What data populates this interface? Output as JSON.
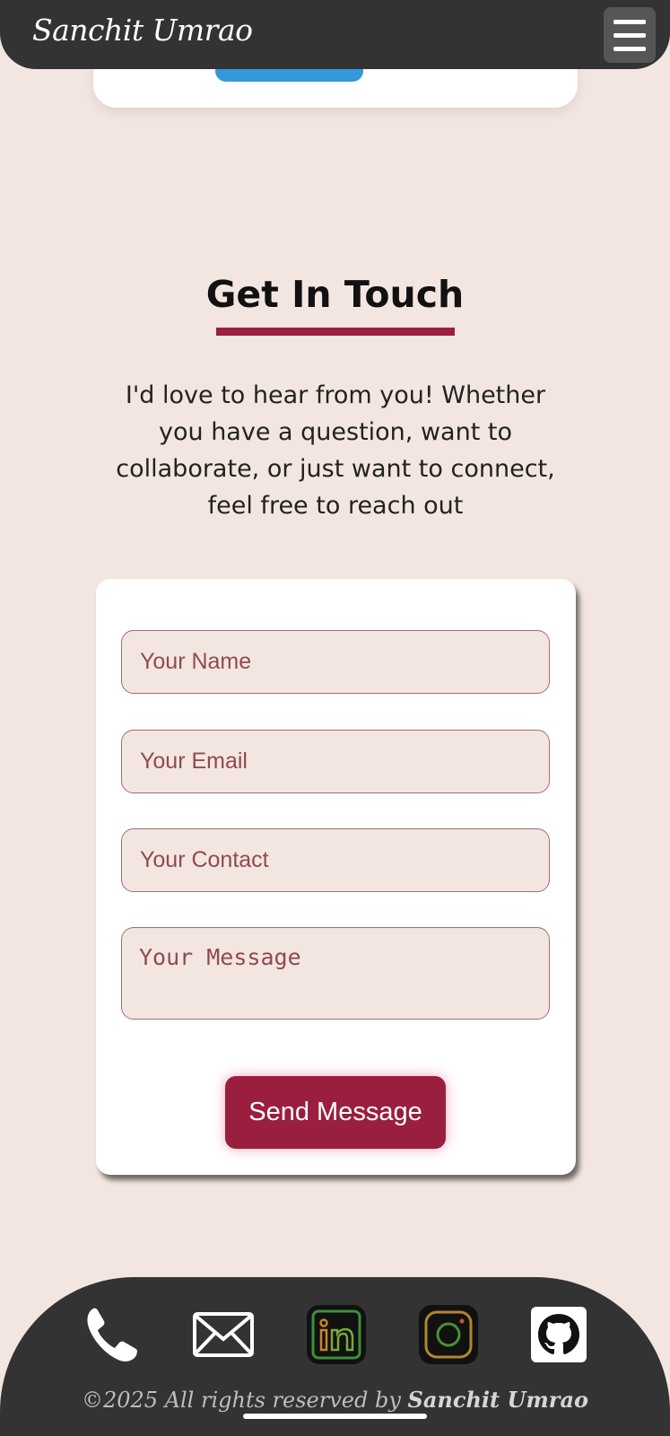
{
  "navbar": {
    "brand": "Sanchit Umrao",
    "menu_icon": "hamburger-menu-icon"
  },
  "contact": {
    "title": "Get In Touch",
    "intro": "I'd love to hear from you! Whether you have a question, want to collaborate, or just want to connect, feel free to reach out",
    "accent_color": "#9a1f3e"
  },
  "form": {
    "name_placeholder": "Your Name",
    "email_placeholder": "Your Email",
    "contact_placeholder": "Your Contact",
    "message_placeholder": "Your Message",
    "submit_label": "Send Message"
  },
  "footer": {
    "icons": [
      "phone-icon",
      "email-icon",
      "linkedin-icon",
      "instagram-icon",
      "github-icon"
    ],
    "copyright_prefix": "©2025 All rights reserved by ",
    "copyright_name": "Sanchit Umrao"
  }
}
